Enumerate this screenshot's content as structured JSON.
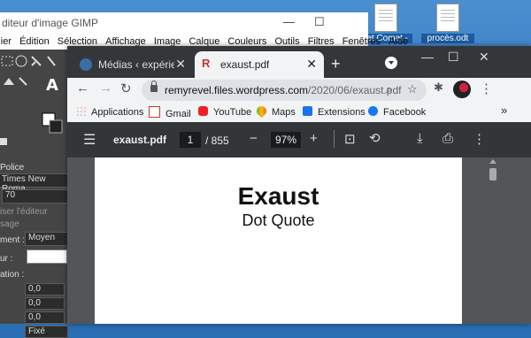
{
  "desktop": {
    "icons": [
      {
        "label": "ret Comet -"
      },
      {
        "label": "procès.odt"
      }
    ]
  },
  "gimp": {
    "title": "diteur d'image GIMP",
    "window_controls": [
      "—",
      "☐"
    ],
    "menu": [
      "Fichier",
      "Édition",
      "Sélection",
      "Affichage",
      "Image",
      "Calque",
      "Couleurs",
      "Outils",
      "Filtres",
      "Fenêtres",
      "Aide"
    ],
    "panel": {
      "police_label": "Police",
      "font_value": "Times New Roma",
      "size_value": "70",
      "use_editor": "iser l'éditeur",
      "usage": "sage",
      "antialias_label": "ment :",
      "antialias_value": "Moyen",
      "color_label": "ur :",
      "justify_label": "ation :",
      "indent_value": "0,0",
      "line_spacing_value": "0,0",
      "letter_spacing_value": "0,0",
      "box_value": "Fixé"
    }
  },
  "chrome": {
    "tabs": [
      {
        "title": "Médias ‹ expérience sc",
        "active": false
      },
      {
        "title": "exaust.pdf",
        "active": true
      }
    ],
    "new_tab": "+",
    "window_controls": [
      "—",
      "☐",
      "✕"
    ],
    "url_domain": "remyrevel.files.wordpress.com",
    "url_path": "/2020/06/exaust.pdf",
    "bookmarks": [
      {
        "label": "Applications",
        "icon": "apps-grid-icon"
      },
      {
        "label": "Gmail",
        "icon": "gmail-icon"
      },
      {
        "label": "YouTube",
        "icon": "youtube-icon"
      },
      {
        "label": "Maps",
        "icon": "maps-icon"
      },
      {
        "label": "Extensions",
        "icon": "puzzle-icon"
      },
      {
        "label": "Facebook",
        "icon": "facebook-icon"
      }
    ],
    "bookmarks_overflow": "»"
  },
  "pdf": {
    "filename": "exaust.pdf",
    "current_page": "1",
    "page_count": "/ 855",
    "zoom": "97%",
    "title": "Exaust",
    "subtitle": "Dot Quote"
  }
}
